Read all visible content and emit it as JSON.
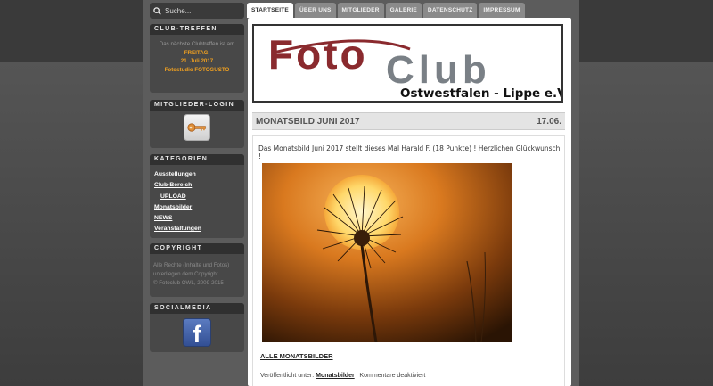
{
  "search": {
    "placeholder": "Suche..."
  },
  "club_meeting": {
    "heading": "CLUB-TREFFEN",
    "line1": "Das nächste Clubtreffen ist am",
    "day": "FREITAG,",
    "date": "21. Juli 2017",
    "place": "Fotostudio FOTOGUSTO"
  },
  "login": {
    "heading": "MITGLIEDER-LOGIN",
    "icon": "key-icon"
  },
  "categories": {
    "heading": "KATEGORIEN",
    "items": [
      {
        "label": "Ausstellungen"
      },
      {
        "label": "Club-Bereich"
      },
      {
        "label": "UPLOAD"
      },
      {
        "label": "Monatsbilder"
      },
      {
        "label": "NEWS"
      },
      {
        "label": "Veranstaltungen"
      }
    ]
  },
  "copyright": {
    "heading": "COPYRIGHT",
    "line1": "Alle Rechte (Inhalte und Fotos)",
    "line2": "unterliegen dem Copyright",
    "line3": "© Fotoclub OWL, 2009-2015"
  },
  "social": {
    "heading": "SOCIALMEDIA",
    "icon": "facebook-icon",
    "fb_glyph": "f"
  },
  "nav": {
    "tabs": [
      {
        "label": "STARTSEITE",
        "active": true
      },
      {
        "label": "ÜBER UNS"
      },
      {
        "label": "MITGLIEDER"
      },
      {
        "label": "GALERIE"
      },
      {
        "label": "DATENSCHUTZ"
      },
      {
        "label": "IMPRESSUM"
      }
    ]
  },
  "logo": {
    "word1": "Foto",
    "word2": "Club",
    "sub": "Ostwestfalen - Lippe e.V."
  },
  "post": {
    "title": "MONATSBILD JUNI 2017",
    "date": "17.06.",
    "intro": "Das Monatsbild Juni 2017 stellt dieses Mal Harald F. (18 Punkte) ! Herzlichen Glückwunsch !",
    "all_link": "ALLE MONATSBILDER",
    "meta_prefix": "Veröffentlicht unter:",
    "meta_category": "Monatsbilder",
    "meta_suffix": "| Kommentare deaktiviert"
  },
  "colors": {
    "accent_orange": "#f0a020",
    "logo_red": "#8a2a2e",
    "logo_grey": "#7a8086",
    "facebook_blue": "#3b5998"
  }
}
